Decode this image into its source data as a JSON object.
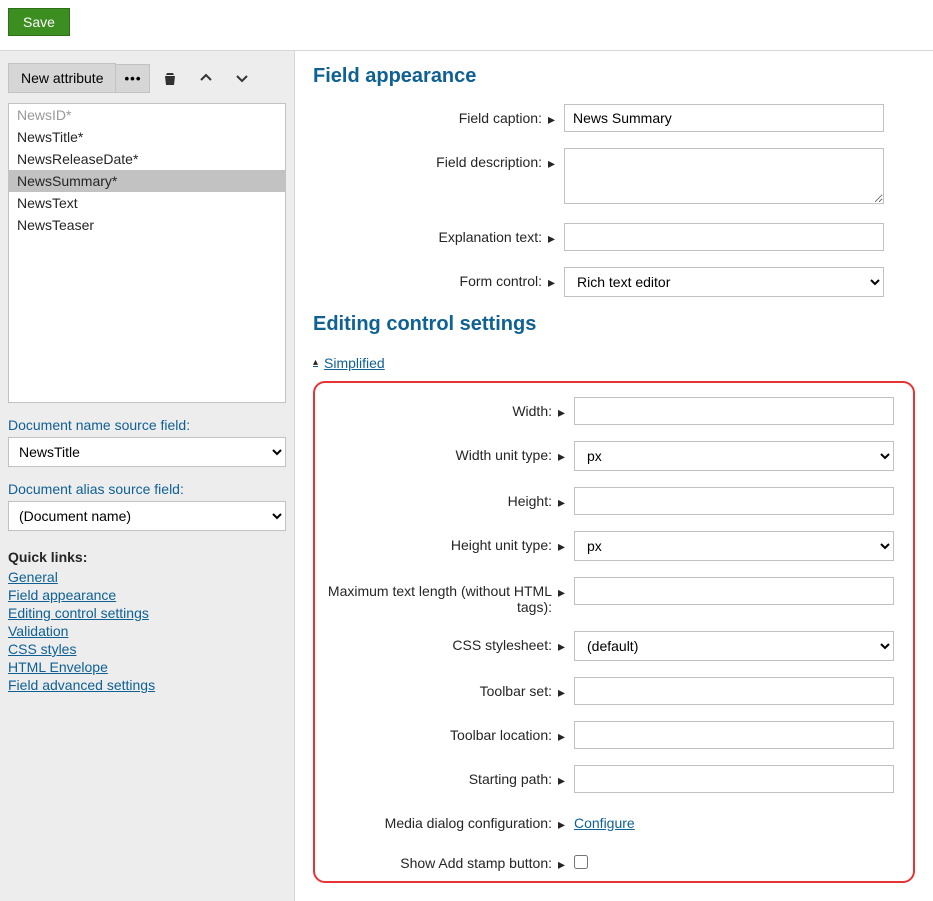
{
  "toolbar": {
    "save_label": "Save"
  },
  "sidebar": {
    "new_attribute_label": "New attribute",
    "more_label": "•••",
    "fields": [
      {
        "label": "NewsID*",
        "disabled": true,
        "selected": false
      },
      {
        "label": "NewsTitle*",
        "disabled": false,
        "selected": false
      },
      {
        "label": "NewsReleaseDate*",
        "disabled": false,
        "selected": false
      },
      {
        "label": "NewsSummary*",
        "disabled": false,
        "selected": true
      },
      {
        "label": "NewsText",
        "disabled": false,
        "selected": false
      },
      {
        "label": "NewsTeaser",
        "disabled": false,
        "selected": false
      }
    ],
    "doc_name_label": "Document name source field:",
    "doc_name_value": "NewsTitle",
    "doc_alias_label": "Document alias source field:",
    "doc_alias_value": "(Document name)",
    "quick_links_title": "Quick links:",
    "quick_links": [
      "General",
      "Field appearance",
      "Editing control settings",
      "Validation",
      "CSS styles",
      "HTML Envelope",
      "Field advanced settings"
    ]
  },
  "main": {
    "section_appearance_title": "Field appearance",
    "field_caption_label": "Field caption:",
    "field_caption_value": "News Summary",
    "field_description_label": "Field description:",
    "explanation_label": "Explanation text:",
    "form_control_label": "Form control:",
    "form_control_value": "Rich text editor",
    "section_editing_title": "Editing control settings",
    "simplified_label": "Simplified",
    "width_label": "Width:",
    "width_unit_label": "Width unit type:",
    "width_unit_value": "px",
    "height_label": "Height:",
    "height_unit_label": "Height unit type:",
    "height_unit_value": "px",
    "max_text_label": "Maximum text length (without HTML tags):",
    "css_label": "CSS stylesheet:",
    "css_value": "(default)",
    "toolbar_set_label": "Toolbar set:",
    "toolbar_loc_label": "Toolbar location:",
    "starting_path_label": "Starting path:",
    "media_dialog_label": "Media dialog configuration:",
    "configure_label": "Configure",
    "stamp_label": "Show Add stamp button:"
  }
}
